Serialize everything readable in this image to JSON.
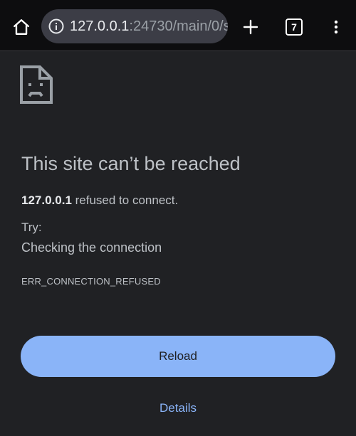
{
  "toolbar": {
    "url_host": "127.0.0.1",
    "url_rest": ":24730/main/0/s",
    "tab_count": "7",
    "icons": {
      "home": "home-icon",
      "info": "info-icon",
      "new_tab": "plus-icon",
      "menu": "more-vert-icon"
    }
  },
  "error_page": {
    "icon": "sad-page-icon",
    "title": "This site can’t be reached",
    "host": "127.0.0.1",
    "message_suffix": " refused to connect.",
    "try_label": "Try:",
    "suggestion": "Checking the connection",
    "error_code": "ERR_CONNECTION_REFUSED",
    "reload_label": "Reload",
    "details_label": "Details"
  },
  "colors": {
    "background": "#202124",
    "toolbar": "#0d0d0f",
    "omnibox": "#3c3d46",
    "accent": "#8ab4f8",
    "text": "#bdc1c6"
  }
}
